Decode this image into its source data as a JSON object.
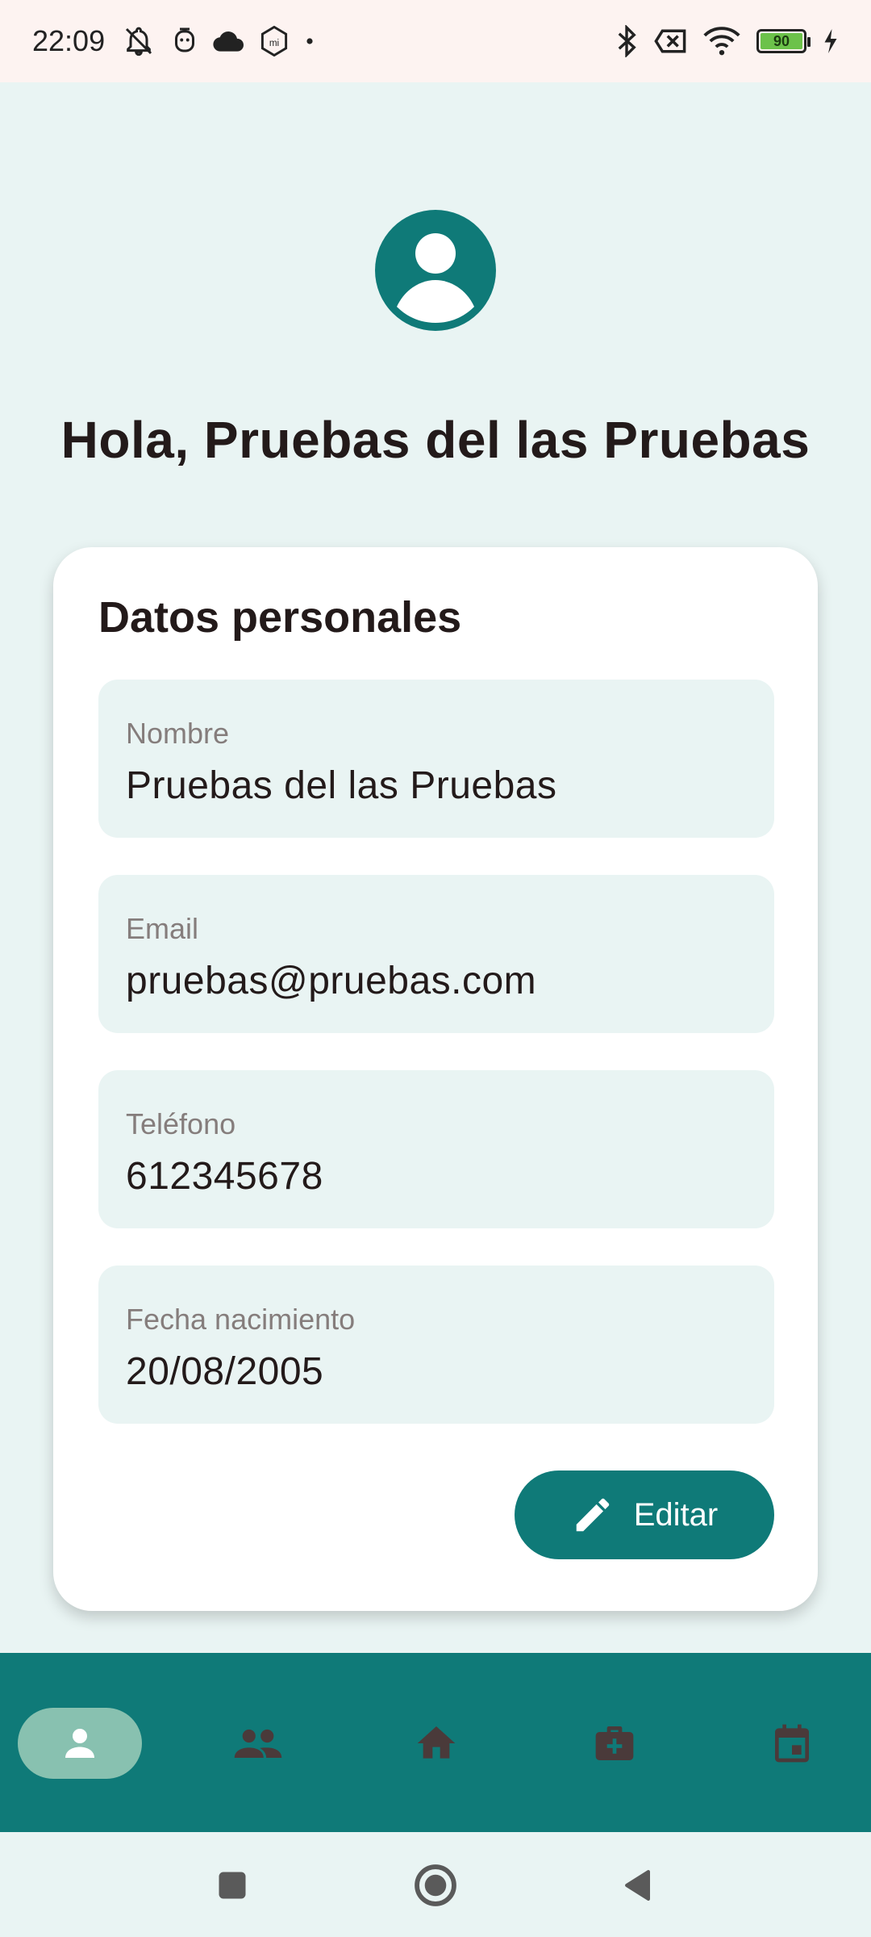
{
  "status_bar": {
    "time": "22:09",
    "battery_level": "90",
    "icons_left": [
      "bell-off-icon",
      "face-icon",
      "cloud-icon",
      "mi-icon",
      "dot-icon"
    ],
    "icons_right": [
      "bluetooth-icon",
      "no-sim-icon",
      "wifi-icon",
      "battery-icon",
      "charging-icon"
    ]
  },
  "profile": {
    "greeting": "Hola, Pruebas del las Pruebas"
  },
  "card": {
    "title": "Datos personales",
    "fields": [
      {
        "label": "Nombre",
        "value": "Pruebas del las Pruebas"
      },
      {
        "label": "Email",
        "value": "pruebas@pruebas.com"
      },
      {
        "label": "Teléfono",
        "value": "612345678"
      },
      {
        "label": "Fecha nacimiento",
        "value": "20/08/2005"
      }
    ],
    "edit_label": "Editar"
  },
  "bottom_nav": {
    "items": [
      {
        "icon": "person-icon",
        "active": true
      },
      {
        "icon": "group-icon",
        "active": false
      },
      {
        "icon": "home-icon",
        "active": false
      },
      {
        "icon": "medical-bag-icon",
        "active": false
      },
      {
        "icon": "calendar-icon",
        "active": false
      }
    ]
  },
  "colors": {
    "accent": "#0f7a78",
    "background": "#e9f4f3",
    "active_pill": "#88c1b0",
    "status_bar": "#fdf3f1"
  }
}
